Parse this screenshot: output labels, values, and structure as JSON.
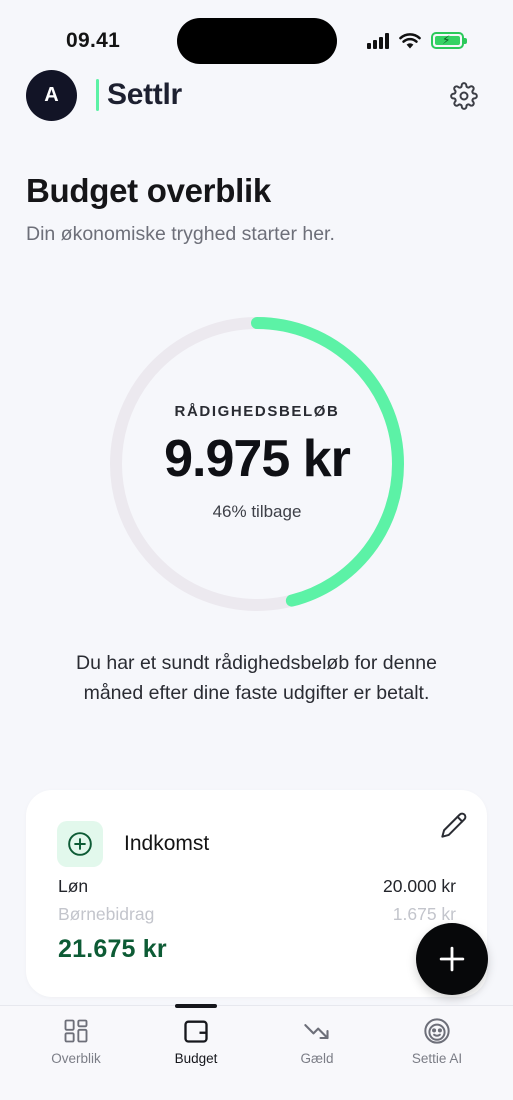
{
  "status_bar": {
    "time": "09.41"
  },
  "header": {
    "avatar_initial": "A",
    "brand_name": "Settlr",
    "settings_icon": "gear-icon"
  },
  "page": {
    "title": "Budget overblik",
    "subtitle": "Din økonomiske tryghed starter her."
  },
  "budget_ring": {
    "label": "RÅDIGHEDSBELØB",
    "amount": "9.975 kr",
    "remaining_text": "46% tilbage",
    "remaining_fraction": 0.46,
    "progress_color": "#5cf2a6",
    "track_color": "#ece9ef"
  },
  "info_text": "Du har et sundt rådighedsbeløb for denne måned efter dine faste udgifter er betalt.",
  "income_card": {
    "title": "Indkomst",
    "icon": "plus-circle-icon",
    "edit_icon": "pencil-icon",
    "rows": [
      {
        "label": "Løn",
        "value": "20.000 kr"
      },
      {
        "label": "Børnebidrag",
        "value": "1.675 kr"
      }
    ],
    "total": "21.675 kr"
  },
  "fab": {
    "icon": "plus-icon"
  },
  "tabs": [
    {
      "label": "Overblik",
      "icon": "grid-icon",
      "active": false
    },
    {
      "label": "Budget",
      "icon": "wallet-icon",
      "active": true
    },
    {
      "label": "Gæld",
      "icon": "trend-down-icon",
      "active": false
    },
    {
      "label": "Settie AI",
      "icon": "smiley-icon",
      "active": false
    }
  ],
  "colors": {
    "accent": "#5cf2a6",
    "income_total": "#0d5b35",
    "dark": "#121426"
  }
}
